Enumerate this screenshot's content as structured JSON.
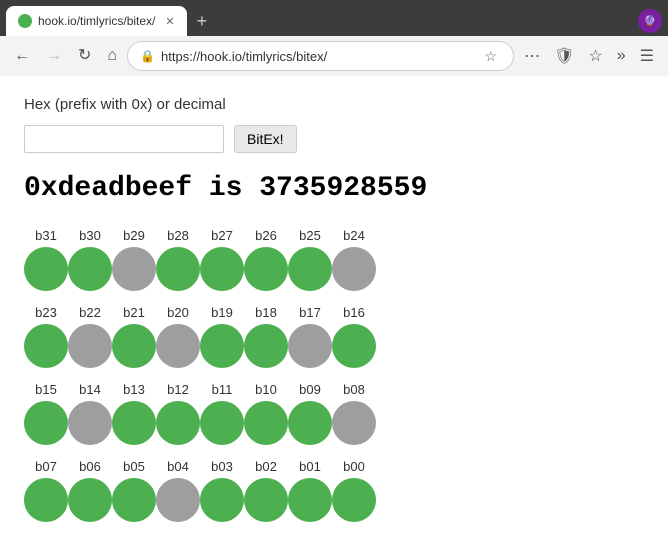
{
  "browser": {
    "tab_title": "hook.io/timlyrics/bitex/",
    "tab_favicon": "green",
    "url": "https://hook.io/timlyrics/bitex/",
    "url_display": "https://hook.io/timlyrics/bitex/",
    "profile_icon": "🔮",
    "nav": {
      "back_disabled": false,
      "forward_disabled": true
    }
  },
  "page": {
    "label": "Hex (prefix with 0x) or decimal",
    "input_value": "",
    "input_placeholder": "",
    "button_label": "BitEx!",
    "result_text": "0xdeadbeef is 3735928559",
    "value": 3735928559,
    "hex_value": "0xdeadbeef",
    "bits": [
      1,
      1,
      0,
      1,
      1,
      1,
      1,
      0,
      1,
      0,
      1,
      0,
      1,
      1,
      0,
      1,
      1,
      0,
      1,
      1,
      1,
      1,
      1,
      0,
      1,
      1,
      1,
      0,
      1,
      1,
      1,
      1
    ]
  },
  "bit_rows": [
    {
      "labels": [
        "b31",
        "b30",
        "b29",
        "b28",
        "b27",
        "b26",
        "b25",
        "b24"
      ],
      "values": [
        1,
        1,
        0,
        1,
        1,
        1,
        1,
        0
      ]
    },
    {
      "labels": [
        "b23",
        "b22",
        "b21",
        "b20",
        "b19",
        "b18",
        "b17",
        "b16"
      ],
      "values": [
        1,
        0,
        1,
        0,
        1,
        1,
        0,
        1
      ]
    },
    {
      "labels": [
        "b15",
        "b14",
        "b13",
        "b12",
        "b11",
        "b10",
        "b09",
        "b08"
      ],
      "values": [
        1,
        0,
        1,
        1,
        1,
        1,
        1,
        0
      ]
    },
    {
      "labels": [
        "b07",
        "b06",
        "b05",
        "b04",
        "b03",
        "b02",
        "b01",
        "b00"
      ],
      "values": [
        1,
        1,
        1,
        0,
        1,
        1,
        1,
        1
      ]
    }
  ]
}
